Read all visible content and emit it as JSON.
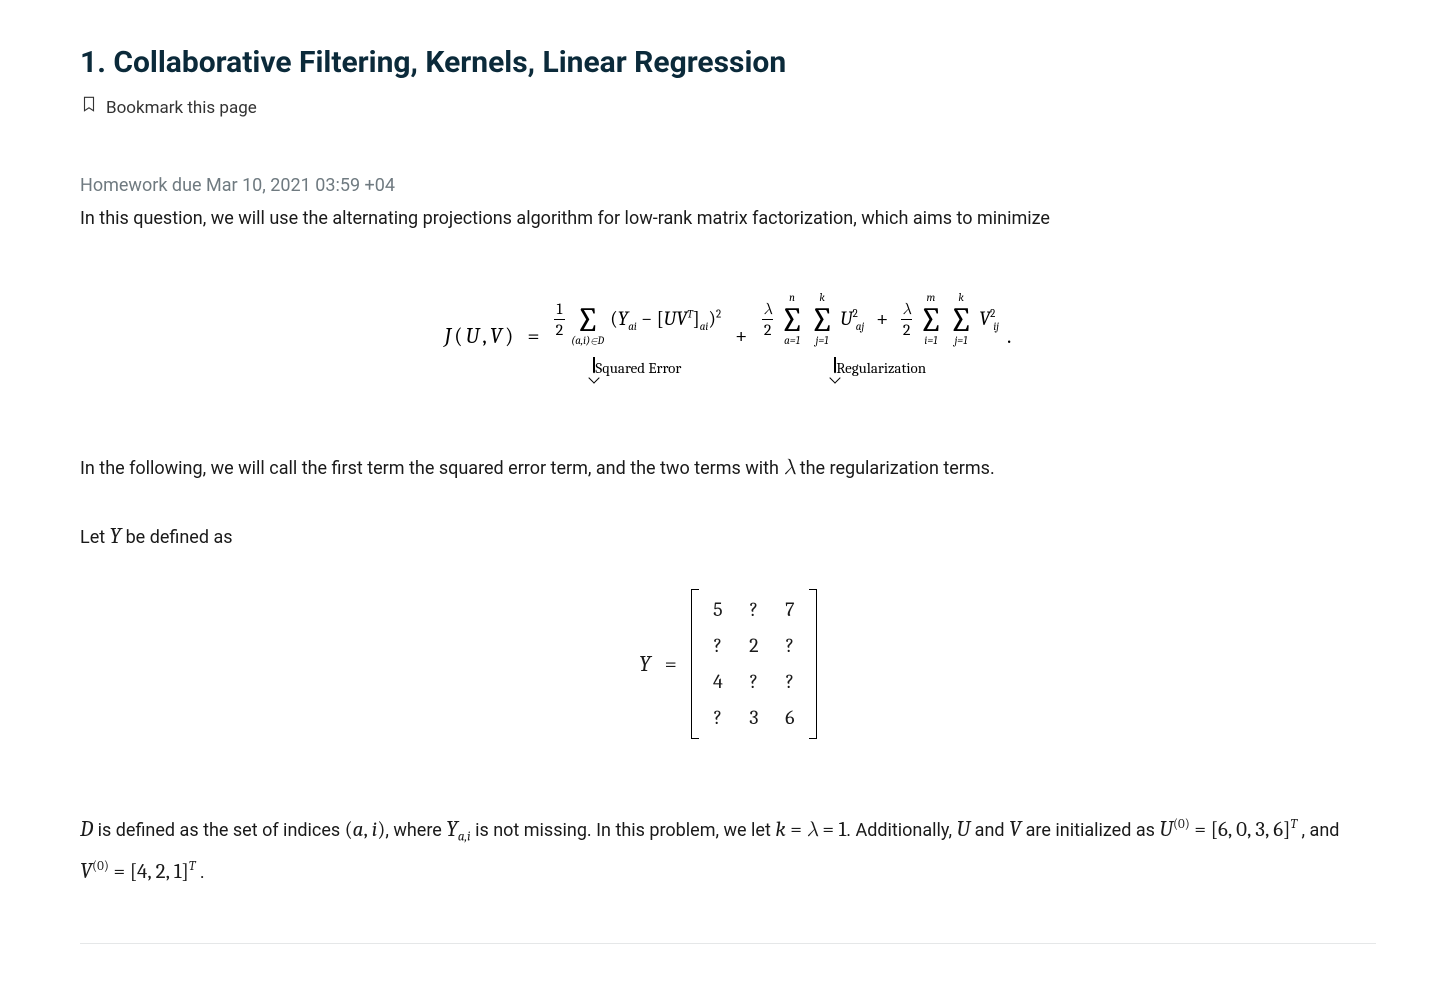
{
  "header": {
    "title": "1. Collaborative Filtering, Kernels, Linear Regression",
    "bookmark_label": "Bookmark this page"
  },
  "meta": {
    "due_line": "Homework due Mar 10, 2021 03:59 +04"
  },
  "intro": "In this question, we will use the alternating projections algorithm for low-rank matrix factorization, which aims to minimize",
  "equation": {
    "lhs_J": "J",
    "lhs_open": "(",
    "lhs_U": "U",
    "lhs_comma": ",",
    "lhs_V": "V",
    "lhs_close": ")",
    "eq": "=",
    "frac1_num": "1",
    "frac1_den": "2",
    "sum1_lower": "(a,i)∈D",
    "sum1_sym": "∑",
    "term1_open": "(",
    "term1_Y": "Y",
    "term1_Ysub": "ai",
    "term1_minus": " − [",
    "term1_U": "U",
    "term1_V": "V",
    "term1_T": "T",
    "term1_close_br": "]",
    "term1_sub_ai": "ai",
    "term1_close": ")",
    "term1_sq": "2",
    "brace1": "Squared Error",
    "plus": "+",
    "lambda": "λ",
    "frac2_den": "2",
    "sum2a_lower": "a=1",
    "sum2a_upper": "n",
    "sum2b_lower": "j=1",
    "sum2b_upper": "k",
    "term2_U": "U",
    "term2_sub": "aj",
    "term2_sq": "2",
    "sum3a_lower": "i=1",
    "sum3a_upper": "m",
    "sum3b_lower": "j=1",
    "sum3b_upper": "k",
    "term3_V": "V",
    "term3_sub": "ij",
    "term3_sq": "2",
    "period": ".",
    "brace2": "Regularization"
  },
  "para2_pre": "In the following, we will call the first term the squared error term, and the two terms with ",
  "para2_lambda": "λ",
  "para2_post": " the regularization terms.",
  "para3_pre": "Let ",
  "para3_Y": "Y",
  "para3_post": " be defined as",
  "matrix": {
    "lhs": "Y",
    "eq": "=",
    "rows": [
      [
        "5",
        "?",
        "7"
      ],
      [
        "?",
        "2",
        "?"
      ],
      [
        "4",
        "?",
        "?"
      ],
      [
        "?",
        "3",
        "6"
      ]
    ]
  },
  "final": {
    "t1": "D",
    "t2": " is defined as the set of indices ",
    "t3": "(a, i)",
    "t4": ", where ",
    "t5": "Y",
    "t5sub": "a,i",
    "t6": " is not missing. In this problem, we let ",
    "t7": "k = λ = 1",
    "t8": ". Additionally, ",
    "t9": "U",
    "t10": " and ",
    "t11": "V",
    "t12": " are initialized as ",
    "t13_lhs": "U",
    "t13_sup": "(0)",
    "t13_eq": " = ",
    "t13_vec": "[6, 0, 3, 6]",
    "t13_T": "T",
    "t14": " , and ",
    "t15_lhs": "V",
    "t15_sup": "(0)",
    "t15_eq": " = ",
    "t15_vec": "[4, 2, 1]",
    "t15_T": "T",
    "t16": " ."
  }
}
